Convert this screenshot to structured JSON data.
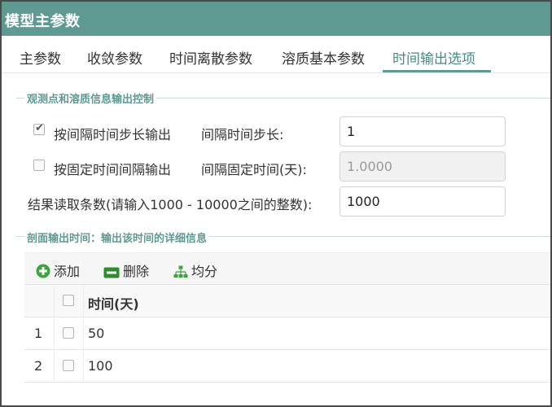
{
  "window": {
    "title": "模型主参数"
  },
  "tabs": [
    {
      "label": "主参数"
    },
    {
      "label": "收敛参数"
    },
    {
      "label": "时间离散参数"
    },
    {
      "label": "溶质基本参数"
    },
    {
      "label": "时间输出选项"
    }
  ],
  "active_tab": "时间输出选项",
  "group1": {
    "label": "观测点和溶质信息输出控制",
    "interval_step": {
      "checked": true,
      "label": "按间隔时间步长输出",
      "field_label": "间隔时间步长:",
      "value": "1"
    },
    "fixed_time": {
      "checked": false,
      "label": "按固定时间间隔输出",
      "field_label": "间隔固定时间(天):",
      "value": "1.0000"
    },
    "read_count": {
      "label": "结果读取条数(请输入1000 - 10000之间的整数):",
      "value": "1000"
    }
  },
  "group2": {
    "label": "剖面输出时间：输出该时间的详细信息",
    "toolbar": {
      "add": "添加",
      "delete": "删除",
      "average": "均分"
    },
    "table": {
      "header": "时间(天)",
      "rows": [
        {
          "index": "1",
          "value": "50"
        },
        {
          "index": "2",
          "value": "100"
        }
      ]
    }
  },
  "colors": {
    "titlebar": "#5f9a92",
    "accent": "#4a8c84",
    "add_icon": "#3aa53a",
    "delete_icon": "#2e8b2e"
  }
}
